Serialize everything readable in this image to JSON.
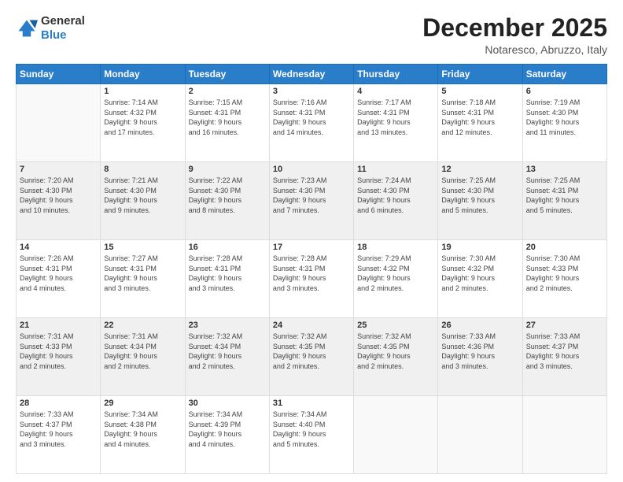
{
  "logo": {
    "general": "General",
    "blue": "Blue"
  },
  "header": {
    "month": "December 2025",
    "location": "Notaresco, Abruzzo, Italy"
  },
  "weekdays": [
    "Sunday",
    "Monday",
    "Tuesday",
    "Wednesday",
    "Thursday",
    "Friday",
    "Saturday"
  ],
  "weeks": [
    [
      {
        "day": "",
        "info": ""
      },
      {
        "day": "1",
        "info": "Sunrise: 7:14 AM\nSunset: 4:32 PM\nDaylight: 9 hours\nand 17 minutes."
      },
      {
        "day": "2",
        "info": "Sunrise: 7:15 AM\nSunset: 4:31 PM\nDaylight: 9 hours\nand 16 minutes."
      },
      {
        "day": "3",
        "info": "Sunrise: 7:16 AM\nSunset: 4:31 PM\nDaylight: 9 hours\nand 14 minutes."
      },
      {
        "day": "4",
        "info": "Sunrise: 7:17 AM\nSunset: 4:31 PM\nDaylight: 9 hours\nand 13 minutes."
      },
      {
        "day": "5",
        "info": "Sunrise: 7:18 AM\nSunset: 4:31 PM\nDaylight: 9 hours\nand 12 minutes."
      },
      {
        "day": "6",
        "info": "Sunrise: 7:19 AM\nSunset: 4:30 PM\nDaylight: 9 hours\nand 11 minutes."
      }
    ],
    [
      {
        "day": "7",
        "info": "Sunrise: 7:20 AM\nSunset: 4:30 PM\nDaylight: 9 hours\nand 10 minutes."
      },
      {
        "day": "8",
        "info": "Sunrise: 7:21 AM\nSunset: 4:30 PM\nDaylight: 9 hours\nand 9 minutes."
      },
      {
        "day": "9",
        "info": "Sunrise: 7:22 AM\nSunset: 4:30 PM\nDaylight: 9 hours\nand 8 minutes."
      },
      {
        "day": "10",
        "info": "Sunrise: 7:23 AM\nSunset: 4:30 PM\nDaylight: 9 hours\nand 7 minutes."
      },
      {
        "day": "11",
        "info": "Sunrise: 7:24 AM\nSunset: 4:30 PM\nDaylight: 9 hours\nand 6 minutes."
      },
      {
        "day": "12",
        "info": "Sunrise: 7:25 AM\nSunset: 4:30 PM\nDaylight: 9 hours\nand 5 minutes."
      },
      {
        "day": "13",
        "info": "Sunrise: 7:25 AM\nSunset: 4:31 PM\nDaylight: 9 hours\nand 5 minutes."
      }
    ],
    [
      {
        "day": "14",
        "info": "Sunrise: 7:26 AM\nSunset: 4:31 PM\nDaylight: 9 hours\nand 4 minutes."
      },
      {
        "day": "15",
        "info": "Sunrise: 7:27 AM\nSunset: 4:31 PM\nDaylight: 9 hours\nand 3 minutes."
      },
      {
        "day": "16",
        "info": "Sunrise: 7:28 AM\nSunset: 4:31 PM\nDaylight: 9 hours\nand 3 minutes."
      },
      {
        "day": "17",
        "info": "Sunrise: 7:28 AM\nSunset: 4:31 PM\nDaylight: 9 hours\nand 3 minutes."
      },
      {
        "day": "18",
        "info": "Sunrise: 7:29 AM\nSunset: 4:32 PM\nDaylight: 9 hours\nand 2 minutes."
      },
      {
        "day": "19",
        "info": "Sunrise: 7:30 AM\nSunset: 4:32 PM\nDaylight: 9 hours\nand 2 minutes."
      },
      {
        "day": "20",
        "info": "Sunrise: 7:30 AM\nSunset: 4:33 PM\nDaylight: 9 hours\nand 2 minutes."
      }
    ],
    [
      {
        "day": "21",
        "info": "Sunrise: 7:31 AM\nSunset: 4:33 PM\nDaylight: 9 hours\nand 2 minutes."
      },
      {
        "day": "22",
        "info": "Sunrise: 7:31 AM\nSunset: 4:34 PM\nDaylight: 9 hours\nand 2 minutes."
      },
      {
        "day": "23",
        "info": "Sunrise: 7:32 AM\nSunset: 4:34 PM\nDaylight: 9 hours\nand 2 minutes."
      },
      {
        "day": "24",
        "info": "Sunrise: 7:32 AM\nSunset: 4:35 PM\nDaylight: 9 hours\nand 2 minutes."
      },
      {
        "day": "25",
        "info": "Sunrise: 7:32 AM\nSunset: 4:35 PM\nDaylight: 9 hours\nand 2 minutes."
      },
      {
        "day": "26",
        "info": "Sunrise: 7:33 AM\nSunset: 4:36 PM\nDaylight: 9 hours\nand 3 minutes."
      },
      {
        "day": "27",
        "info": "Sunrise: 7:33 AM\nSunset: 4:37 PM\nDaylight: 9 hours\nand 3 minutes."
      }
    ],
    [
      {
        "day": "28",
        "info": "Sunrise: 7:33 AM\nSunset: 4:37 PM\nDaylight: 9 hours\nand 3 minutes."
      },
      {
        "day": "29",
        "info": "Sunrise: 7:34 AM\nSunset: 4:38 PM\nDaylight: 9 hours\nand 4 minutes."
      },
      {
        "day": "30",
        "info": "Sunrise: 7:34 AM\nSunset: 4:39 PM\nDaylight: 9 hours\nand 4 minutes."
      },
      {
        "day": "31",
        "info": "Sunrise: 7:34 AM\nSunset: 4:40 PM\nDaylight: 9 hours\nand 5 minutes."
      },
      {
        "day": "",
        "info": ""
      },
      {
        "day": "",
        "info": ""
      },
      {
        "day": "",
        "info": ""
      }
    ]
  ]
}
